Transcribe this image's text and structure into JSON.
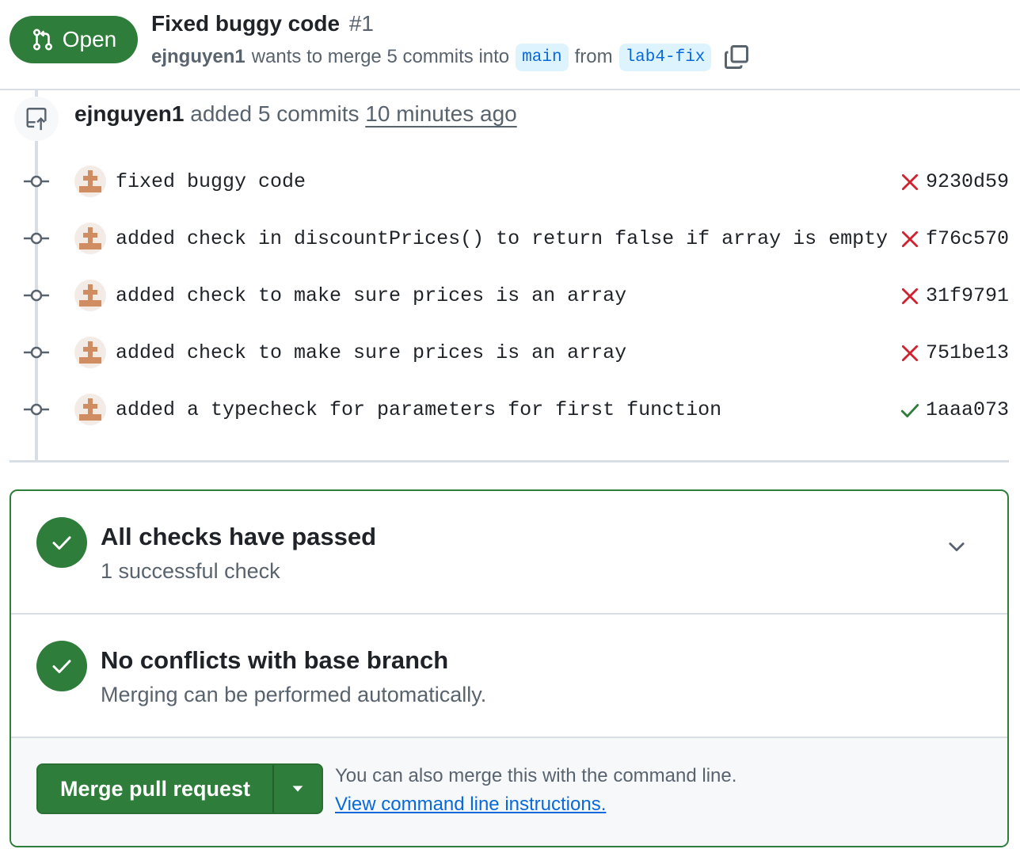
{
  "header": {
    "state_label": "Open",
    "title": "Fixed buggy code",
    "number": "#1",
    "author": "ejnguyen1",
    "merge_text": "wants to merge 5 commits into",
    "base_branch": "main",
    "from_text": "from",
    "head_branch": "lab4-fix"
  },
  "timeline": {
    "event_author": "ejnguyen1",
    "event_action": "added 5 commits",
    "event_time": "10 minutes ago",
    "commits": [
      {
        "message": "fixed buggy code",
        "status": "failed",
        "sha": "9230d59"
      },
      {
        "message": "added check in discountPrices() to return false if array is empty",
        "status": "failed",
        "sha": "f76c570"
      },
      {
        "message": "added check to make sure prices is an array",
        "status": "failed",
        "sha": "31f9791"
      },
      {
        "message": "added check to make sure prices is an array",
        "status": "failed",
        "sha": "751be13"
      },
      {
        "message": "added a typecheck for parameters for first function",
        "status": "success",
        "sha": "1aaa073"
      }
    ]
  },
  "merge_box": {
    "checks_title": "All checks have passed",
    "checks_sub": "1 successful check",
    "conflicts_title": "No conflicts with base branch",
    "conflicts_sub": "Merging can be performed automatically.",
    "merge_button": "Merge pull request",
    "hint": "You can also merge this with the command line.",
    "link": "View command line instructions."
  },
  "colors": {
    "success_green": "#2f7d3b",
    "fail_red": "#cf222e",
    "link_blue": "#0969da",
    "muted": "#59636e"
  },
  "icons": {
    "state": "git-pull-request-icon",
    "copy": "copy-icon",
    "event": "repo-push-icon",
    "commit": "git-commit-icon",
    "fail": "x-icon",
    "pass": "check-icon",
    "chevron": "chevron-down-icon",
    "triangle": "triangle-down-icon"
  }
}
